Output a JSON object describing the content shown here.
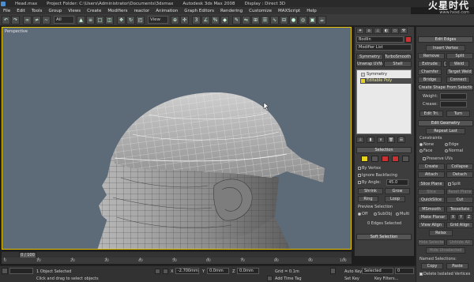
{
  "titlebar": {
    "file": "Head.max",
    "project": "Project Folder: C:\\Users\\Administrator\\Documents\\3dsmax",
    "app": "Autodesk 3ds Max 2008",
    "display": "Display : Direct 3D"
  },
  "watermark": {
    "main": "火星时代",
    "sub": "www.hxsd.com"
  },
  "menu": [
    "File",
    "Edit",
    "Tools",
    "Group",
    "Views",
    "Create",
    "Modifiers",
    "reactor",
    "Animation",
    "Graph Editors",
    "Rendering",
    "Customize",
    "MAXScript",
    "Help"
  ],
  "toolbar": {
    "selection_filter": "All",
    "view_dropdown": "View"
  },
  "viewport": {
    "label": "Perspective"
  },
  "command_panel": {
    "object_name": "Bodlin",
    "modifier_list": "Modifier List",
    "buttons": {
      "symmetry": "Symmetry",
      "turbosmooth": "TurboSmooth",
      "unwrap_uvw": "Unwrap UVW",
      "shell": "Shell"
    },
    "stack": [
      "Symmetry",
      "Editable Poly"
    ],
    "selection": {
      "header": "Selection",
      "by_vertex": "By Vertex",
      "ignore_backfacing": "Ignore Backfacing",
      "by_angle": "By Angle:",
      "angle_value": "45.0",
      "shrink": "Shrink",
      "grow": "Grow",
      "ring": "Ring",
      "loop": "Loop",
      "preview_label": "Preview Selection",
      "preview_off": "Off",
      "preview_subobj": "SubObj",
      "preview_multi": "Multi",
      "status": "0 Edges Selected"
    },
    "soft_selection": "Soft Selection"
  },
  "right_panel": {
    "edit_edges": {
      "header": "Edit Edges",
      "insert_vertex": "Insert Vertex",
      "remove": "Remove",
      "split": "Split",
      "extrude": "Extrude",
      "weld": "Weld",
      "chamfer": "Chamfer",
      "target_weld": "Target Weld",
      "bridge": "Bridge",
      "connect": "Connect",
      "create_shape": "Create Shape From Selection",
      "weight": "Weight:",
      "crease": "Crease:",
      "edit_tri": "Edit Tri.",
      "turn": "Turn"
    },
    "edit_geometry": {
      "header": "Edit Geometry",
      "repeat_last": "Repeat Last",
      "constraints": "Constraints",
      "none": "None",
      "edge": "Edge",
      "face": "Face",
      "normal": "Normal",
      "preserve_uvs": "Preserve UVs",
      "create": "Create",
      "collapse": "Collapse",
      "attach": "Attach",
      "detach": "Detach",
      "slice_plane": "Slice Plane",
      "split": "Split",
      "slice": "Slice",
      "reset_plane": "Reset Plane",
      "quickslice": "QuickSlice",
      "cut": "Cut",
      "msmooth": "MSmooth",
      "tessellate": "Tessellate",
      "make_planar": "Make Planar",
      "x": "X",
      "y": "Y",
      "z": "Z",
      "view_align": "View Align",
      "grid_align": "Grid Align",
      "relax": "Relax",
      "hide_selected": "Hide Selected",
      "unhide_all": "Unhide All",
      "hide_unselected": "Hide Unselected",
      "named_selections": "Named Selections:",
      "copy": "Copy",
      "paste": "Paste",
      "delete_isolated": "Delete Isolated Vertices"
    }
  },
  "timeline": {
    "slider_label": "0 / 100",
    "ticks": [
      "0",
      "10",
      "20",
      "30",
      "40",
      "50",
      "60",
      "70",
      "80",
      "90",
      "100"
    ]
  },
  "statusbar": {
    "object_count": "1 Object Selected",
    "prompt": "Click and drag to select objects",
    "x_val": "-2.700mm",
    "y_val": "0.0mm",
    "z_val": "0.0mm",
    "grid": "Grid = 0.1m",
    "add_time_tag": "Add Time Tag",
    "auto_key": "Auto Key",
    "selected": "Selected",
    "set_key": "Set Key",
    "key_filters": "Key Filters...",
    "frame": "0"
  },
  "colors": {
    "viewport_bg": "#5d6a78",
    "active_border": "#e6c200",
    "accent_red": "#c83232",
    "accent_yellow": "#e6d21e"
  }
}
